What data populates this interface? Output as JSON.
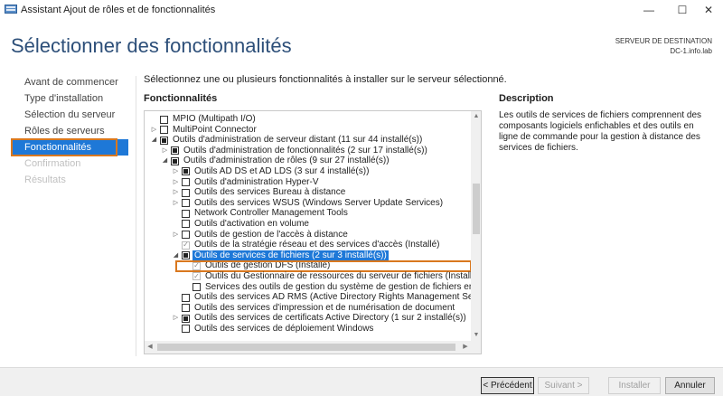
{
  "window": {
    "title": "Assistant Ajout de rôles et de fonctionnalités",
    "minimize_glyph": "—",
    "maximize_glyph": "☐",
    "close_glyph": "✕"
  },
  "header": {
    "page_title": "Sélectionner des fonctionnalités",
    "dest_label": "SERVEUR DE DESTINATION",
    "dest_server": "DC-1.info.lab"
  },
  "nav": {
    "items": [
      {
        "label": "Avant de commencer",
        "state": "normal"
      },
      {
        "label": "Type d'installation",
        "state": "normal"
      },
      {
        "label": "Sélection du serveur",
        "state": "normal"
      },
      {
        "label": "Rôles de serveurs",
        "state": "normal"
      },
      {
        "label": "Fonctionnalités",
        "state": "active"
      },
      {
        "label": "Confirmation",
        "state": "disabled"
      },
      {
        "label": "Résultats",
        "state": "disabled"
      }
    ]
  },
  "main": {
    "instruction": "Sélectionnez une ou plusieurs fonctionnalités à installer sur le serveur sélectionné.",
    "features_header": "Fonctionnalités",
    "description_header": "Description",
    "description_text": "Les outils de services de fichiers comprennent des composants logiciels enfichables et des outils en ligne de commande pour la gestion à distance des services de fichiers."
  },
  "tree": {
    "items": [
      {
        "label": "MPIO (Multipath I/O)",
        "level": 0,
        "expander": "none",
        "check": "unchecked"
      },
      {
        "label": "MultiPoint Connector",
        "level": 0,
        "expander": "collapsed",
        "check": "unchecked"
      },
      {
        "label": "Outils d'administration de serveur distant (11 sur 44 installé(s))",
        "level": 0,
        "expander": "expanded",
        "check": "partial"
      },
      {
        "label": "Outils d'administration de fonctionnalités (2 sur 17 installé(s))",
        "level": 1,
        "expander": "collapsed",
        "check": "partial"
      },
      {
        "label": "Outils d'administration de rôles (9 sur 27 installé(s))",
        "level": 1,
        "expander": "expanded",
        "check": "partial"
      },
      {
        "label": "Outils AD DS et AD LDS (3 sur 4 installé(s))",
        "level": 2,
        "expander": "collapsed",
        "check": "partial"
      },
      {
        "label": "Outils d'administration Hyper-V",
        "level": 2,
        "expander": "collapsed",
        "check": "unchecked"
      },
      {
        "label": "Outils des services Bureau à distance",
        "level": 2,
        "expander": "collapsed",
        "check": "unchecked"
      },
      {
        "label": "Outils des services WSUS (Windows Server Update Services)",
        "level": 2,
        "expander": "collapsed",
        "check": "unchecked"
      },
      {
        "label": "Network Controller Management Tools",
        "level": 2,
        "expander": "none",
        "check": "unchecked"
      },
      {
        "label": "Outils d'activation en volume",
        "level": 2,
        "expander": "none",
        "check": "unchecked"
      },
      {
        "label": "Outils de gestion de l'accès à distance",
        "level": 2,
        "expander": "collapsed",
        "check": "unchecked"
      },
      {
        "label": "Outils de la stratégie réseau et des services d'accès (Installé)",
        "level": 2,
        "expander": "none",
        "check": "checked-disabled"
      },
      {
        "label": "Outils de services de fichiers (2 sur 3 installé(s))",
        "level": 2,
        "expander": "expanded",
        "check": "partial",
        "selected": true
      },
      {
        "label": "Outils de gestion DFS (Installé)",
        "level": 3,
        "expander": "none",
        "check": "checked-disabled",
        "highlighted": true
      },
      {
        "label": "Outils du Gestionnaire de ressources du serveur de fichiers (Installé)",
        "level": 3,
        "expander": "none",
        "check": "checked-disabled"
      },
      {
        "label": "Services des outils de gestion du système de gestion de fichiers en réseau",
        "level": 3,
        "expander": "none",
        "check": "unchecked"
      },
      {
        "label": "Outils des services AD RMS (Active Directory Rights Management Services)",
        "level": 2,
        "expander": "none",
        "check": "unchecked"
      },
      {
        "label": "Outils des services d'impression et de numérisation de document",
        "level": 2,
        "expander": "none",
        "check": "unchecked"
      },
      {
        "label": "Outils des services de certificats Active Directory (1 sur 2 installé(s))",
        "level": 2,
        "expander": "collapsed",
        "check": "partial"
      },
      {
        "label": "Outils des services de déploiement Windows",
        "level": 2,
        "expander": "none",
        "check": "unchecked"
      }
    ]
  },
  "footer": {
    "prev_label": "< Précédent",
    "next_label": "Suivant >",
    "install_label": "Installer",
    "cancel_label": "Annuler"
  },
  "colors": {
    "accent": "#1e78d7",
    "highlight_outline": "#d9781f",
    "title_blue": "#2d4f79"
  },
  "icons": {
    "app": "server-manager-icon",
    "expanded": "triangle-down-icon",
    "collapsed": "triangle-right-icon"
  }
}
